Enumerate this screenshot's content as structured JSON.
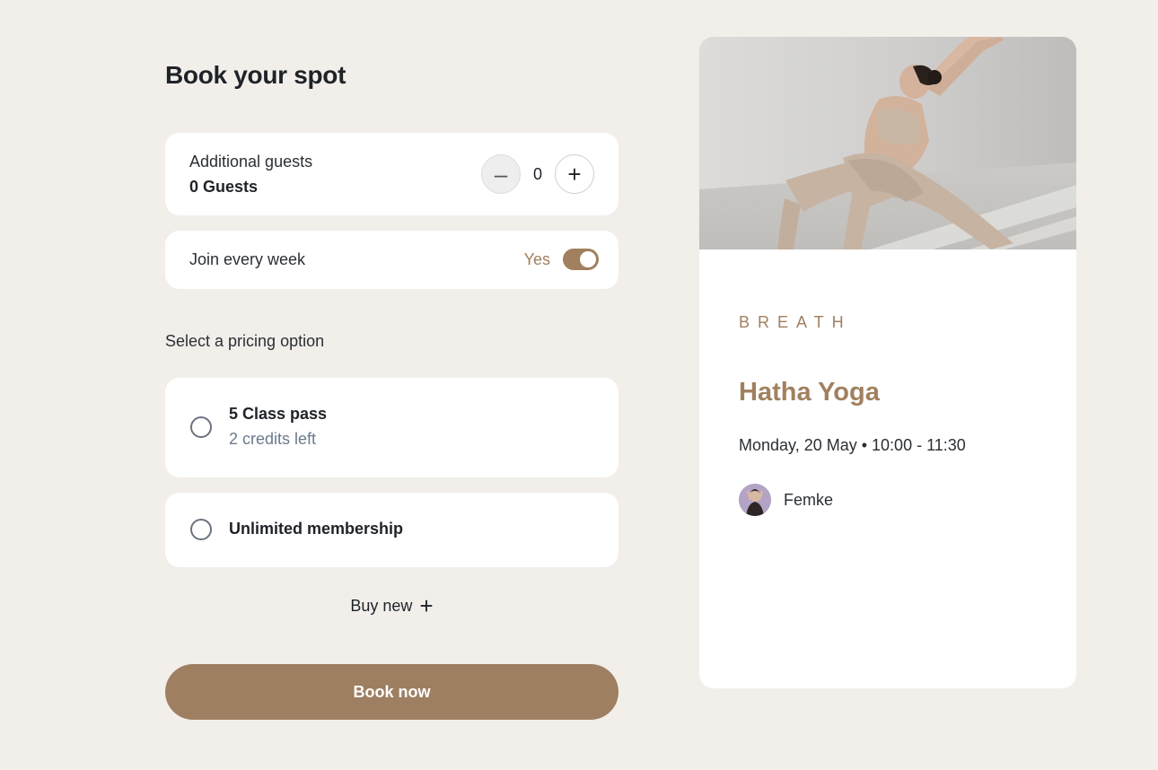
{
  "booking": {
    "title": "Book your spot",
    "guests": {
      "label": "Additional guests",
      "value": "0 Guests",
      "count": "0",
      "minus": "–",
      "plus": "+"
    },
    "weekly": {
      "label": "Join every week",
      "toggle_label": "Yes",
      "enabled": true
    },
    "pricing_label": "Select a pricing option",
    "options": [
      {
        "title": "5 Class pass",
        "subtitle": "2 credits left",
        "selected": false
      },
      {
        "title": "Unlimited membership",
        "selected": false
      }
    ],
    "buy_new": "Buy new",
    "book_button": "Book now"
  },
  "class_card": {
    "brand": "BREATH",
    "title": "Hatha Yoga",
    "datetime": "Monday, 20 May • 10:00 - 11:30",
    "instructor": "Femke"
  },
  "colors": {
    "accent": "#a0805f",
    "background": "#f2efeb",
    "card": "#ffffff"
  }
}
